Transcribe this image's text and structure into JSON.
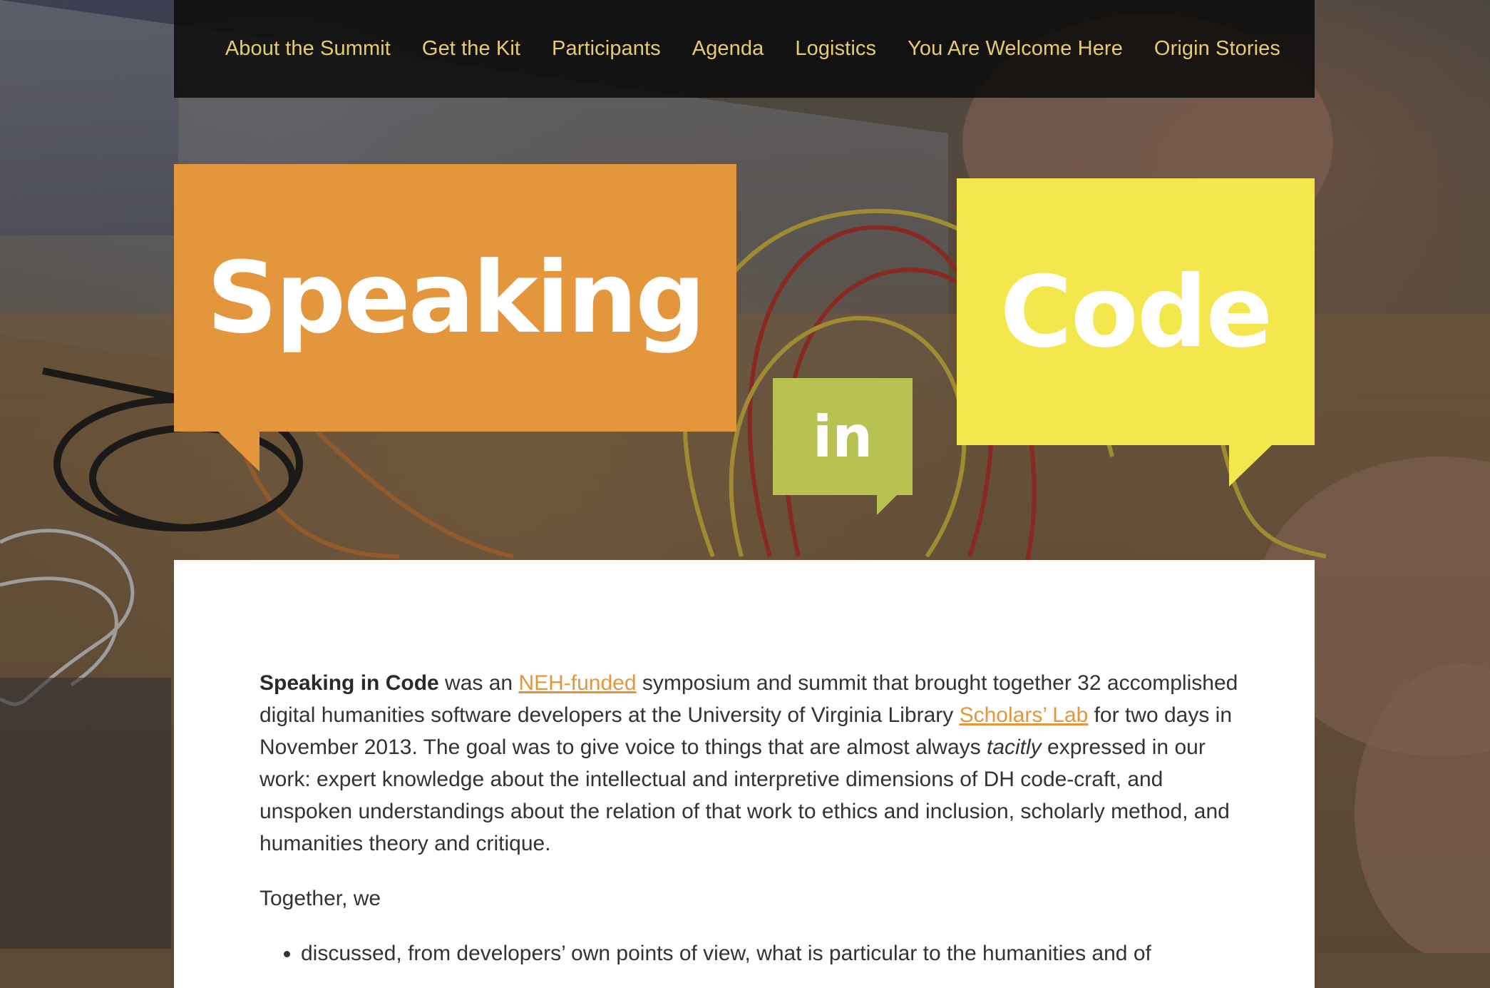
{
  "nav": {
    "items": [
      {
        "label": "About the Summit"
      },
      {
        "label": "Get the Kit"
      },
      {
        "label": "Participants"
      },
      {
        "label": "Agenda"
      },
      {
        "label": "Logistics"
      },
      {
        "label": "You Are Welcome Here"
      },
      {
        "label": "Origin Stories"
      }
    ]
  },
  "hero": {
    "word1": "Speaking",
    "word2": "in",
    "word3": "Code"
  },
  "intro": {
    "title_bold": "Speaking in Code",
    "t1": " was an ",
    "link1": "NEH-funded",
    "t2": " symposium and summit that brought together 32 accomplished digital humanities software developers at the University of Virginia Library ",
    "link2": "Scholars’ Lab",
    "t3": " for two days in November 2013. The goal was to give voice to things that are almost always ",
    "em": "tacitly",
    "t4": " expressed in our work: expert knowledge about the intellectual and interpretive dimensions of DH code-craft, and unspoken understandings about the relation of that work to ethics and inclusion, scholarly method, and humanities theory and critique."
  },
  "together": "Together, we",
  "bullets": [
    "discussed, from developers’ own points of view, what is particular to the humanities and of"
  ],
  "colors": {
    "orange": "#e4963d",
    "green": "#b8c253",
    "yellow": "#f4e74e",
    "nav_text": "#e7cc6f"
  }
}
